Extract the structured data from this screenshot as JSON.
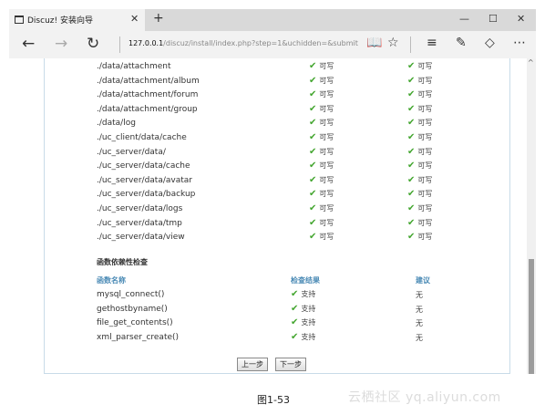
{
  "browser": {
    "tab_title": "Discuz! 安装向导",
    "tab_close": "✕",
    "new_tab": "+",
    "window_controls": {
      "minimize": "—",
      "maximize": "☐",
      "close": "✕"
    },
    "url_host": "127.0.0.1",
    "url_path": "/discuz/install/index.php?step=1&uchidden=&submit",
    "icons": [
      "back-arrow",
      "forward-arrow",
      "refresh",
      "reading-view",
      "favorite-star",
      "hub",
      "web-note",
      "share",
      "more"
    ]
  },
  "directories": [
    {
      "path": "./data/attachment",
      "current": "可写",
      "required": "可写"
    },
    {
      "path": "./data/attachment/album",
      "current": "可写",
      "required": "可写"
    },
    {
      "path": "./data/attachment/forum",
      "current": "可写",
      "required": "可写"
    },
    {
      "path": "./data/attachment/group",
      "current": "可写",
      "required": "可写"
    },
    {
      "path": "./data/log",
      "current": "可写",
      "required": "可写"
    },
    {
      "path": "./uc_client/data/cache",
      "current": "可写",
      "required": "可写"
    },
    {
      "path": "./uc_server/data/",
      "current": "可写",
      "required": "可写"
    },
    {
      "path": "./uc_server/data/cache",
      "current": "可写",
      "required": "可写"
    },
    {
      "path": "./uc_server/data/avatar",
      "current": "可写",
      "required": "可写"
    },
    {
      "path": "./uc_server/data/backup",
      "current": "可写",
      "required": "可写"
    },
    {
      "path": "./uc_server/data/logs",
      "current": "可写",
      "required": "可写"
    },
    {
      "path": "./uc_server/data/tmp",
      "current": "可写",
      "required": "可写"
    },
    {
      "path": "./uc_server/data/view",
      "current": "可写",
      "required": "可写"
    }
  ],
  "functions": {
    "title": "函数依赖性检查",
    "headers": {
      "name": "函数名称",
      "result": "检查结果",
      "advice": "建议"
    },
    "rows": [
      {
        "name": "mysql_connect()",
        "result": "支持",
        "advice": "无"
      },
      {
        "name": "gethostbyname()",
        "result": "支持",
        "advice": "无"
      },
      {
        "name": "file_get_contents()",
        "result": "支持",
        "advice": "无"
      },
      {
        "name": "xml_parser_create()",
        "result": "支持",
        "advice": "无"
      }
    ]
  },
  "buttons": {
    "prev": "上一步",
    "next": "下一步"
  },
  "caption": "图1-53",
  "watermark": "云栖社区 yq.aliyun.com",
  "colors": {
    "check": "#44a630",
    "header_blue": "#4a8ab5",
    "scroll_thumb": "#9c9c9c"
  }
}
